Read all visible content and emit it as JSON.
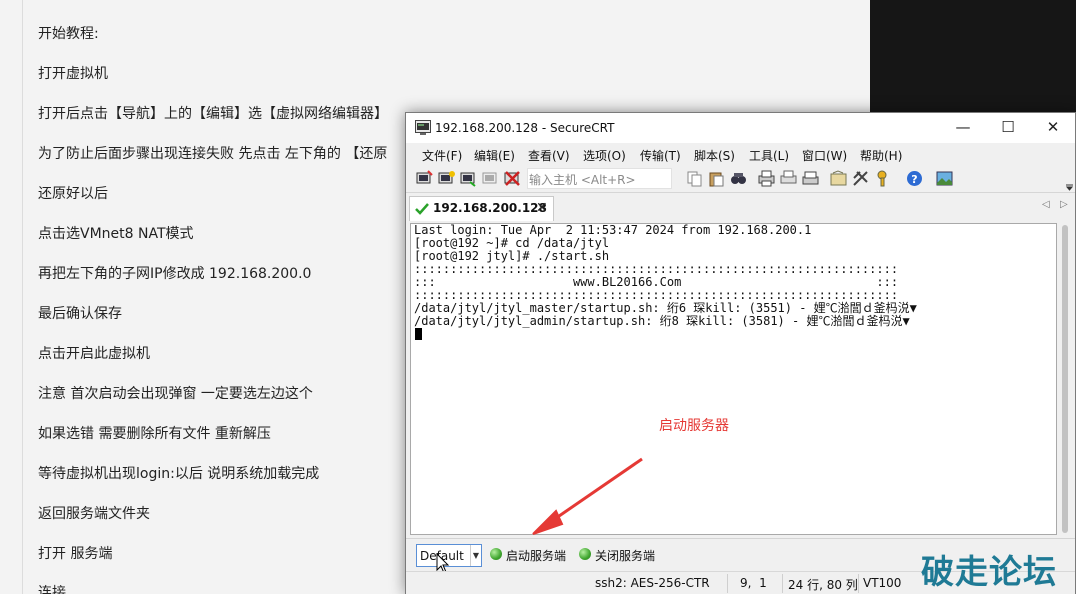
{
  "document": {
    "lines": [
      "开始教程:",
      "打开虚拟机",
      "打开后点击【导航】上的【编辑】选【虚拟网络编辑器】",
      "为了防止后面步骤出现连接失败 先点击 左下角的 【还原",
      "还原好以后",
      "点击选VMnet8 NAT模式",
      "再把左下角的子网IP修改成 192.168.200.0",
      "最后确认保存",
      "点击开启此虚拟机",
      "注意 首次启动会出现弹窗 一定要选左边这个",
      "如果选错 需要删除所有文件 重新解压",
      "等待虚拟机出现login:以后 说明系统加载完成",
      "返回服务端文件夹",
      "打开 服务端",
      "连接"
    ]
  },
  "window": {
    "title": "192.168.200.128 - SecureCRT",
    "minimize": "—",
    "maximize": "☐",
    "close": "✕"
  },
  "menu": [
    "文件(F)",
    "编辑(E)",
    "查看(V)",
    "选项(O)",
    "传输(T)",
    "脚本(S)",
    "工具(L)",
    "窗口(W)",
    "帮助(H)"
  ],
  "toolbar": {
    "quick_connect_placeholder": "输入主机 <Alt+R>"
  },
  "tab": {
    "label": "192.168.200.128",
    "close": "✕",
    "prev": "◁",
    "next": "▷"
  },
  "terminal": {
    "lines": [
      "Last login: Tue Apr  2 11:53:47 2024 from 192.168.200.1",
      "[root@192 ~]# cd /data/jtyl",
      "[root@192 jtyl]# ./start.sh",
      ":::::::::::::::::::::::::::::::::::::::::::::::::::::::::::::::::::",
      ":::                   www.BL20166.Com                           :::",
      ":::::::::::::::::::::::::::::::::::::::::::::::::::::::::::::::::::",
      "/data/jtyl/jtyl_master/startup.sh: 绗6 琛kill: (3551) - 娌℃湁閭ｄ釜杩涚▼",
      "/data/jtyl/jtyl_admin/startup.sh: 绗8 琛kill: (3581) - 娌℃湁閭ｄ釜杩涚▼"
    ]
  },
  "annotation": {
    "text": "启动服务器",
    "color": "#e53935"
  },
  "button_bar": {
    "selected": "Default",
    "buttons": [
      "启动服务端",
      "关闭服务端"
    ]
  },
  "status_bar": {
    "cipher": "ssh2: AES-256-CTR",
    "cursor_pos": "9,  1",
    "size": "24 行, 80 列",
    "terminal_type": "VT100"
  },
  "watermark": {
    "text": "破走论坛"
  }
}
